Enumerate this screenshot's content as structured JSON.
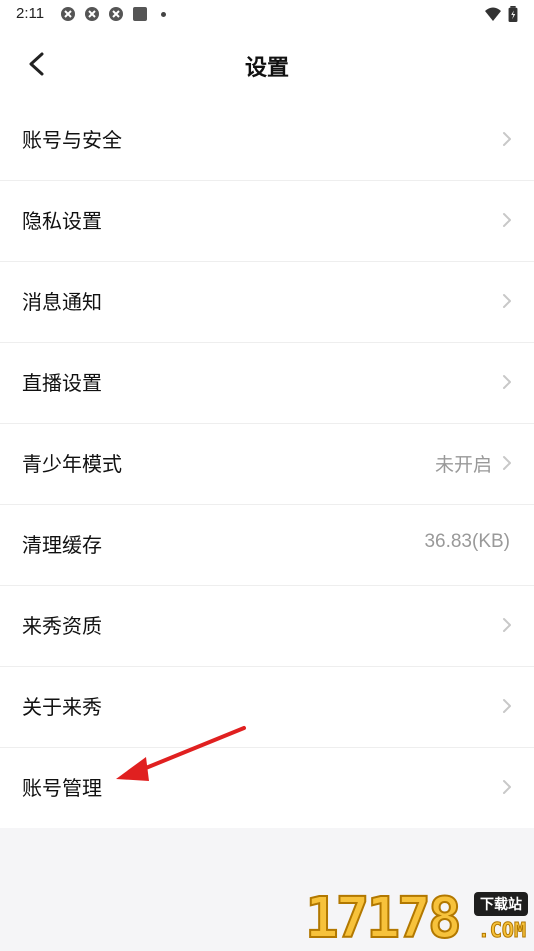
{
  "status_bar": {
    "time": "2:11",
    "icons": [
      "notification-icon",
      "notification-icon",
      "notification-icon",
      "square-icon",
      "wifi-icon",
      "battery-icon"
    ]
  },
  "header": {
    "title": "设置",
    "back_icon": "back-chevron-icon"
  },
  "settings": [
    {
      "id": "account-security",
      "label": "账号与安全",
      "value": "",
      "chevron": true
    },
    {
      "id": "privacy",
      "label": "隐私设置",
      "value": "",
      "chevron": true
    },
    {
      "id": "notifications",
      "label": "消息通知",
      "value": "",
      "chevron": true
    },
    {
      "id": "live-settings",
      "label": "直播设置",
      "value": "",
      "chevron": true
    },
    {
      "id": "teen-mode",
      "label": "青少年模式",
      "value": "未开启",
      "chevron": true
    },
    {
      "id": "clear-cache",
      "label": "清理缓存",
      "value": "36.83(KB)",
      "chevron": false
    },
    {
      "id": "qualification",
      "label": "来秀资质",
      "value": "",
      "chevron": true
    },
    {
      "id": "about",
      "label": "关于来秀",
      "value": "",
      "chevron": true
    },
    {
      "id": "account-management",
      "label": "账号管理",
      "value": "",
      "chevron": true
    }
  ],
  "annotation": {
    "type": "red-arrow",
    "target": "账号管理",
    "color": "#e02020"
  },
  "watermark": {
    "number": "17178",
    "tag": "下载站",
    "suffix": ".COM"
  },
  "colors": {
    "background": "#f5f5f7",
    "row_bg": "#ffffff",
    "divider": "#eeeeee",
    "secondary_text": "#999999",
    "chevron": "#c8c8c8",
    "arrow": "#e02020"
  }
}
